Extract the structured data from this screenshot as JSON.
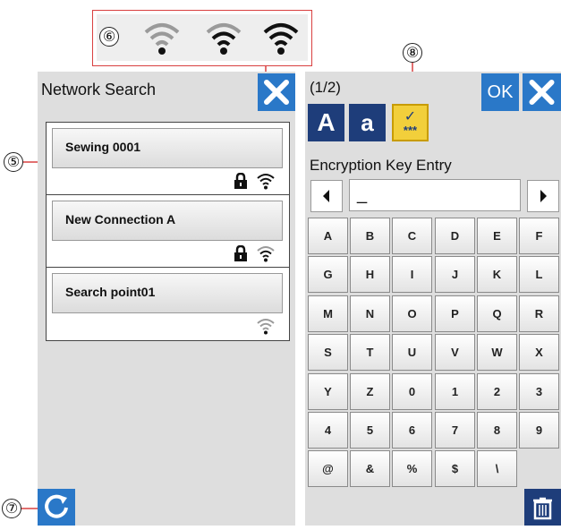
{
  "left": {
    "title": "Network Search",
    "networks": [
      {
        "name": "Sewing 0001",
        "locked": true,
        "signal": "strong"
      },
      {
        "name": "New Connection A",
        "locked": true,
        "signal": "medium"
      },
      {
        "name": "Search point01",
        "locked": false,
        "signal": "weak"
      }
    ]
  },
  "right": {
    "page_indicator": "(1/2)",
    "ok_label": "OK",
    "mode_upper": "A",
    "mode_lower": "a",
    "mode_hidden_mark": "✓",
    "mode_hidden_stars": "***",
    "section_title": "Encryption Key Entry",
    "input_value": "_",
    "keys": [
      "A",
      "B",
      "C",
      "D",
      "E",
      "F",
      "G",
      "H",
      "I",
      "J",
      "K",
      "L",
      "M",
      "N",
      "O",
      "P",
      "Q",
      "R",
      "S",
      "T",
      "U",
      "V",
      "W",
      "X",
      "Y",
      "Z",
      "0",
      "1",
      "2",
      "3",
      "4",
      "5",
      "6",
      "7",
      "8",
      "9",
      "@",
      "&",
      "%",
      "$",
      "\\"
    ]
  },
  "callouts": {
    "c5": "⑤",
    "c6": "⑥",
    "c7": "⑦",
    "c8": "⑧"
  },
  "colors": {
    "panel_bg": "#dedede",
    "blue_button": "#2a78c8",
    "navy_button": "#1e3d7a",
    "hidden_mode_yellow": "#f2cf3b",
    "callout_red": "#d94040"
  }
}
